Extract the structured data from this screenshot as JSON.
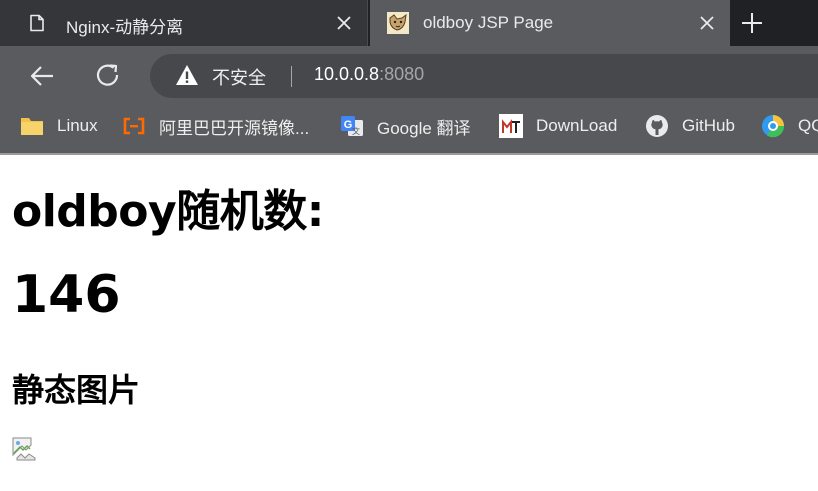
{
  "tabs": [
    {
      "title": "Nginx-动静分离",
      "favicon": "document-icon",
      "active": false
    },
    {
      "title": "oldboy JSP Page",
      "favicon": "tomcat-icon",
      "active": true
    }
  ],
  "toolbar": {
    "security_label": "不安全",
    "url_host": "10.0.0.8",
    "url_port": ":8080"
  },
  "bookmarks": [
    {
      "label": "Linux",
      "icon": "folder-icon"
    },
    {
      "label": "阿里巴巴开源镜像...",
      "icon": "aliyun-icon"
    },
    {
      "label": "Google 翻译",
      "icon": "google-translate-icon"
    },
    {
      "label": "DownLoad",
      "icon": "download-site-icon"
    },
    {
      "label": "GitHub",
      "icon": "github-icon"
    },
    {
      "label": "QQ",
      "icon": "qq-browser-icon"
    }
  ],
  "page": {
    "heading": "oldboy随机数:",
    "number": "146",
    "subheading": "静态图片"
  },
  "colors": {
    "tab_strip": "#202124",
    "active_tab": "#595b5e",
    "toolbar": "#595b5e",
    "omnibox": "#46484b"
  }
}
